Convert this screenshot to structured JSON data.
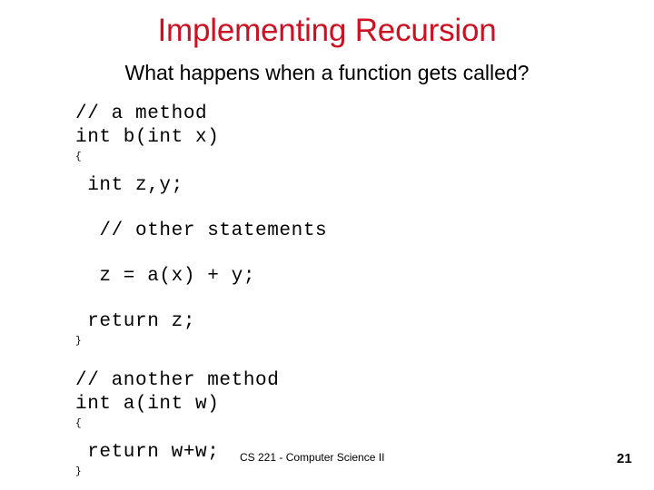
{
  "slide": {
    "title": "Implementing Recursion",
    "title_color": "#cc1122",
    "subtitle": "What happens when a function gets called?",
    "code": {
      "method_b": {
        "comment": "// a method",
        "signature": "int b(int x)",
        "open_brace": "{",
        "declaration": " int z,y;",
        "other_comment": "  // other statements",
        "assignment": "  z = a(x) + y;",
        "return_stmt": " return z;",
        "close_brace": "}"
      },
      "method_a": {
        "comment": "// another method",
        "signature": "int a(int w)",
        "open_brace": "{",
        "return_stmt": " return w+w;",
        "close_brace": "}"
      }
    },
    "footer": "CS 221 - Computer Science II",
    "page_number": "21"
  }
}
